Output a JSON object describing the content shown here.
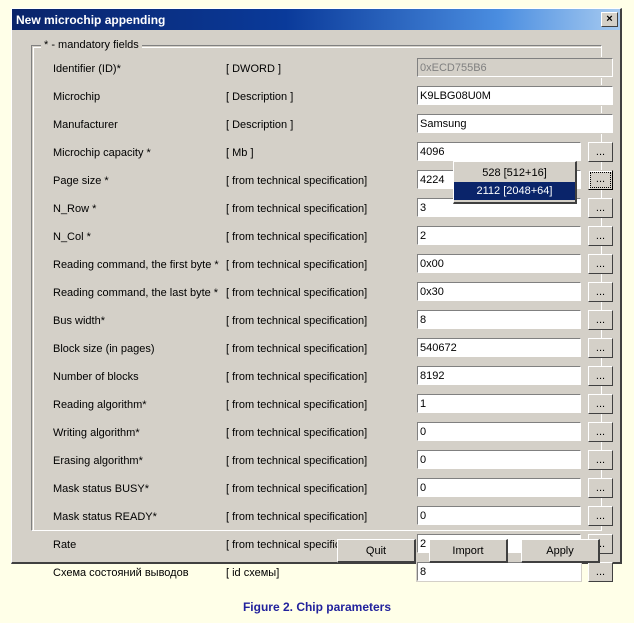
{
  "page": {
    "background_color": "#ffffe8",
    "caption": "Figure 2. Chip parameters",
    "caption_color": "#22229c"
  },
  "dialog": {
    "title": "New microchip appending",
    "titlebar_color": "#0a246a",
    "face_color": "#d4d0c8",
    "close_icon": "close-icon",
    "close_glyph": "×",
    "groupbox_legend": "* - mandatory fields",
    "ellipsis_label": "...",
    "rows": [
      {
        "label": "Identifier (ID)*",
        "spec": "[ DWORD ]",
        "value": "0xECD755B6",
        "disabled": true,
        "wide": true,
        "ellipsis": false,
        "focused": false
      },
      {
        "label": "Microchip",
        "spec": "[ Description ]",
        "value": "K9LBG08U0M",
        "disabled": false,
        "wide": true,
        "ellipsis": false,
        "focused": false
      },
      {
        "label": "Manufacturer",
        "spec": "[ Description ]",
        "value": "Samsung",
        "disabled": false,
        "wide": true,
        "ellipsis": false,
        "focused": false
      },
      {
        "label": "Microchip capacity *",
        "spec": "[ Mb ]",
        "value": "4096",
        "disabled": false,
        "wide": false,
        "ellipsis": true,
        "focused": false
      },
      {
        "label": "Page size *",
        "spec": "[ from technical specification]",
        "value": "4224",
        "disabled": false,
        "wide": false,
        "ellipsis": true,
        "focused": true
      },
      {
        "label": "N_Row *",
        "spec": "[ from technical specification]",
        "value": "3",
        "disabled": false,
        "wide": false,
        "ellipsis": true,
        "focused": false
      },
      {
        "label": "N_Col *",
        "spec": "[ from technical specification]",
        "value": "2",
        "disabled": false,
        "wide": false,
        "ellipsis": true,
        "focused": false
      },
      {
        "label": "Reading command, the first byte *",
        "spec": "[ from technical specification]",
        "value": "0x00",
        "disabled": false,
        "wide": false,
        "ellipsis": true,
        "focused": false
      },
      {
        "label": "Reading command, the last byte *",
        "spec": "[ from technical specification]",
        "value": "0x30",
        "disabled": false,
        "wide": false,
        "ellipsis": true,
        "focused": false
      },
      {
        "label": "Bus width*",
        "spec": "[ from technical specification]",
        "value": "8",
        "disabled": false,
        "wide": false,
        "ellipsis": true,
        "focused": false
      },
      {
        "label": "Block size (in pages)",
        "spec": "[ from technical specification]",
        "value": "540672",
        "disabled": false,
        "wide": false,
        "ellipsis": true,
        "focused": false
      },
      {
        "label": "Number of blocks",
        "spec": "[ from technical specification]",
        "value": "8192",
        "disabled": false,
        "wide": false,
        "ellipsis": true,
        "focused": false
      },
      {
        "label": "Reading algorithm*",
        "spec": "[ from technical specification]",
        "value": "1",
        "disabled": false,
        "wide": false,
        "ellipsis": true,
        "focused": false
      },
      {
        "label": "Writing algorithm*",
        "spec": "[ from technical specification]",
        "value": "0",
        "disabled": false,
        "wide": false,
        "ellipsis": true,
        "focused": false
      },
      {
        "label": "Erasing algorithm*",
        "spec": "[ from technical specification]",
        "value": "0",
        "disabled": false,
        "wide": false,
        "ellipsis": true,
        "focused": false
      },
      {
        "label": "Mask status BUSY*",
        "spec": "[ from technical specification]",
        "value": "0",
        "disabled": false,
        "wide": false,
        "ellipsis": true,
        "focused": false
      },
      {
        "label": "Mask status READY*",
        "spec": "[ from technical specification]",
        "value": "0",
        "disabled": false,
        "wide": false,
        "ellipsis": true,
        "focused": false
      },
      {
        "label": "Rate",
        "spec": "[ from technical specification]",
        "value": "2",
        "disabled": false,
        "wide": false,
        "ellipsis": true,
        "focused": false
      },
      {
        "label": "Схема состояний выводов",
        "spec": "[ id схемы]",
        "value": "8",
        "disabled": false,
        "wide": false,
        "ellipsis": true,
        "focused": false
      }
    ],
    "dropdown": {
      "anchor_row_index": 4,
      "highlight_color": "#0a246a",
      "items": [
        {
          "label": "528  [512+16]",
          "selected": false
        },
        {
          "label": "2112 [2048+64]",
          "selected": true
        }
      ]
    },
    "buttons": [
      {
        "id": "btn-quit",
        "label": "Quit"
      },
      {
        "id": "btn-import",
        "label": "Import"
      },
      {
        "id": "btn-apply",
        "label": "Apply"
      }
    ]
  }
}
